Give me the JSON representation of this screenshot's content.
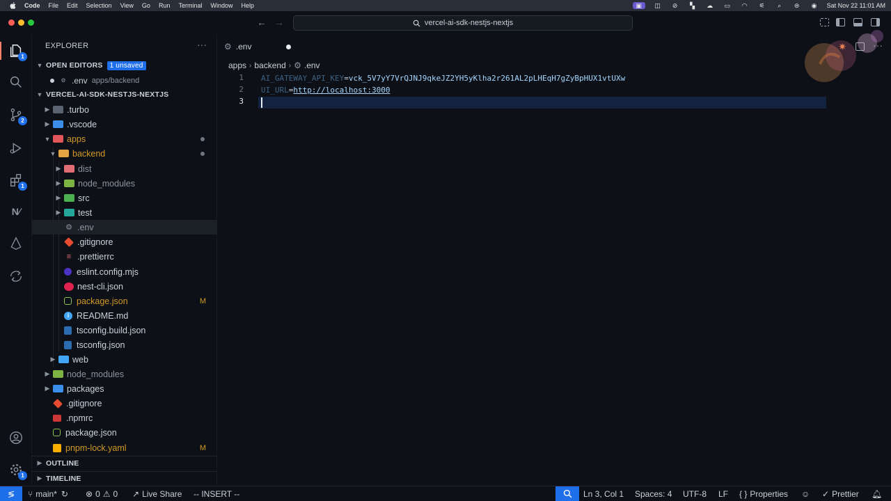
{
  "menubar": {
    "items": [
      "Code",
      "File",
      "Edit",
      "Selection",
      "View",
      "Go",
      "Run",
      "Terminal",
      "Window",
      "Help"
    ],
    "datetime": "Sat Nov 22  11:01 AM"
  },
  "titlebar": {
    "search_text": "vercel-ai-sdk-nestjs-nextjs"
  },
  "activity": {
    "explorer_badge": "1",
    "scm_badge": "2",
    "extensions_badge": "1",
    "settings_badge": "1"
  },
  "sidebar": {
    "title": "EXPLORER",
    "open_editors_label": "OPEN EDITORS",
    "unsaved_label": "1 unsaved",
    "open_file_name": ".env",
    "open_file_path": "apps/backend",
    "project_label": "VERCEL-AI-SDK-NESTJS-NEXTJS",
    "outline_label": "OUTLINE",
    "timeline_label": "TIMELINE",
    "tree": [
      {
        "name": ".turbo"
      },
      {
        "name": ".vscode"
      },
      {
        "name": "apps"
      },
      {
        "name": "backend"
      },
      {
        "name": "dist"
      },
      {
        "name": "node_modules"
      },
      {
        "name": "src"
      },
      {
        "name": "test"
      },
      {
        "name": ".env"
      },
      {
        "name": ".gitignore"
      },
      {
        "name": ".prettierrc"
      },
      {
        "name": "eslint.config.mjs"
      },
      {
        "name": "nest-cli.json"
      },
      {
        "name": "package.json",
        "status": "M"
      },
      {
        "name": "README.md"
      },
      {
        "name": "tsconfig.build.json"
      },
      {
        "name": "tsconfig.json"
      },
      {
        "name": "web"
      },
      {
        "name": "node_modules"
      },
      {
        "name": "packages"
      },
      {
        "name": ".gitignore"
      },
      {
        "name": ".npmrc"
      },
      {
        "name": "package.json"
      },
      {
        "name": "pnpm-lock.yaml",
        "status": "M"
      }
    ]
  },
  "editor": {
    "tab_label": ".env",
    "breadcrumb": [
      "apps",
      "backend",
      ".env"
    ],
    "line_numbers": [
      "1",
      "2",
      "3"
    ],
    "lines": [
      {
        "key": "AI_GATEWAY_API_KEY",
        "eq": "=",
        "value": "vck_5V7yY7VrQJNJ9qkeJZ2YH5yKlha2r261AL2pLHEqH7gZyBpHUX1vtUXw"
      },
      {
        "key": "UI_URL",
        "eq": "=",
        "value": "http://localhost:3000"
      }
    ]
  },
  "statusbar": {
    "branch": "main*",
    "errors": "0",
    "warnings": "0",
    "live_share": "Live Share",
    "mode": "-- INSERT --",
    "position": "Ln 3, Col 1",
    "spaces": "Spaces: 4",
    "encoding": "UTF-8",
    "eol": "LF",
    "language": "Properties",
    "prettier": "Prettier"
  },
  "colors": {
    "accent": "#1f6feb",
    "background": "#0d1117",
    "modified": "#d29922"
  }
}
